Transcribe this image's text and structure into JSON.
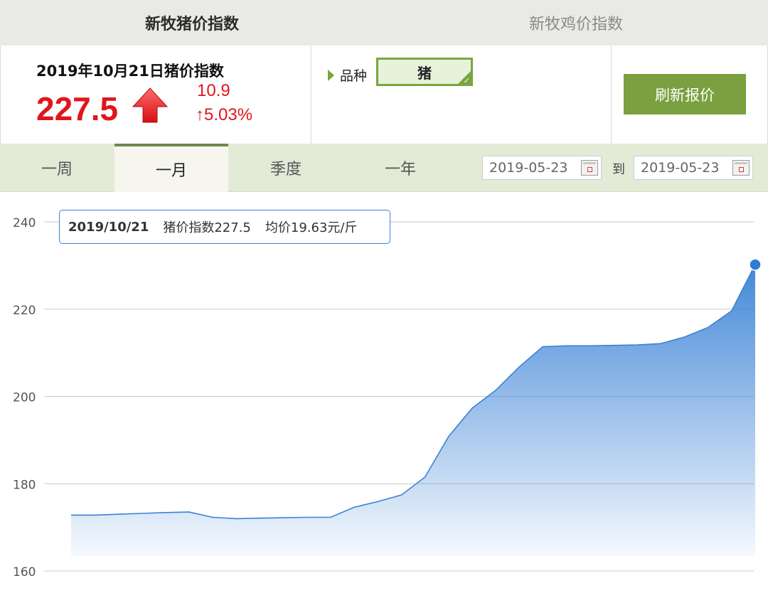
{
  "top_tabs": [
    {
      "label": "新牧猪价指数",
      "active": true
    },
    {
      "label": "新牧鸡价指数",
      "active": false
    }
  ],
  "index_panel": {
    "title": "2019年10月21日猪价指数",
    "value": "227.5",
    "change_abs": "10.9",
    "change_pct": "↑5.03%",
    "trend_icon": "up-arrow-icon"
  },
  "variety": {
    "label": "品种",
    "selected": "猪"
  },
  "refresh_button": "刷新报价",
  "period_tabs": [
    {
      "label": "一周",
      "active": false
    },
    {
      "label": "一月",
      "active": true
    },
    {
      "label": "季度",
      "active": false
    },
    {
      "label": "一年",
      "active": false
    }
  ],
  "date_range": {
    "start": "2019-05-23",
    "separator": "到",
    "end": "2019-05-23"
  },
  "tooltip": {
    "date": "2019/10/21",
    "index_text": "猪价指数227.5",
    "avg_text": "均价19.63元/斤"
  },
  "colors": {
    "accent_green": "#7aa03f",
    "up_red": "#e0161b",
    "series_blue": "#3a82d6"
  },
  "chart_data": {
    "type": "area",
    "ylim": [
      160,
      240
    ],
    "yticks": [
      240,
      220,
      200,
      180,
      160
    ],
    "grid": true,
    "series": [
      {
        "values": [
          172.8,
          172.8,
          173.0,
          173.2,
          173.4,
          173.5,
          172.3,
          172.0,
          172.1,
          172.2,
          172.3,
          172.3,
          174.6,
          175.9,
          177.4,
          181.5,
          190.8,
          197.3,
          201.4,
          206.8,
          211.4,
          211.6,
          211.6,
          211.7,
          211.8,
          212.1,
          213.6,
          215.8,
          219.6,
          230.2
        ]
      }
    ]
  }
}
